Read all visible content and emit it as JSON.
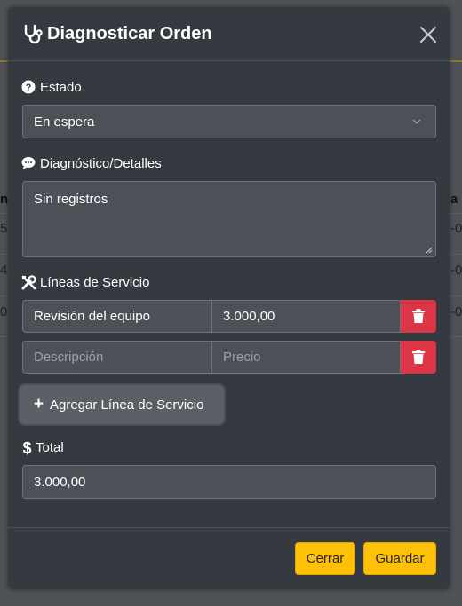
{
  "modal": {
    "title": "Diagnosticar Orden",
    "title_icon": "stethoscope-icon",
    "close_icon": "close-icon"
  },
  "estado": {
    "label": "Estado",
    "icon": "question-circle-icon",
    "selected": "En espera"
  },
  "diagnostico": {
    "label": "Diagnóstico/Detalles",
    "icon": "comment-icon",
    "value": "Sin registros"
  },
  "lineas": {
    "label": "Líneas de Servicio",
    "icon": "tools-icon",
    "rows": [
      {
        "description": "Revisión del equipo",
        "price": "3.000,00"
      },
      {
        "description": "",
        "price": ""
      }
    ],
    "placeholders": {
      "description": "Descripción",
      "price": "Precio"
    },
    "add_label": "Agregar Línea de Servicio"
  },
  "total": {
    "label": "Total",
    "icon": "dollar-icon",
    "value": "3.000,00"
  },
  "footer": {
    "close_label": "Cerrar",
    "save_label": "Guardar"
  },
  "colors": {
    "modal_bg": "#343a40",
    "input_bg": "#4b5157",
    "danger": "#dc3545",
    "warning": "#ffc107"
  }
}
